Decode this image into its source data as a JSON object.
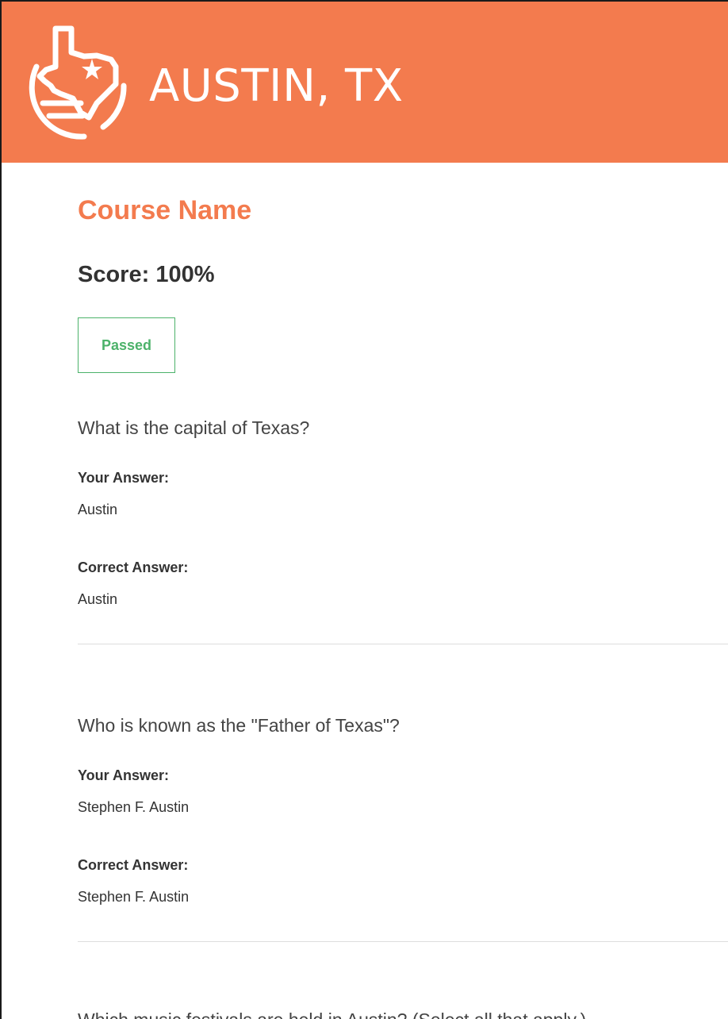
{
  "header": {
    "brand_title": "AUSTIN, TX",
    "logo_icon": "texas-map-star-icon",
    "background_color": "#f37b4e"
  },
  "course": {
    "name": "Course Name",
    "score_text": "Score: 100%",
    "status_badge": "Passed",
    "status_color": "#4cb26a"
  },
  "questions": [
    {
      "question": "What is the capital of Texas?",
      "your_answer_label": "Your Answer:",
      "your_answer": "Austin",
      "correct_answer_label": "Correct Answer:",
      "correct_answer": "Austin"
    },
    {
      "question": "Who is known as the \"Father of Texas\"?",
      "your_answer_label": "Your Answer:",
      "your_answer": "Stephen F. Austin",
      "correct_answer_label": "Correct Answer:",
      "correct_answer": "Stephen F. Austin"
    },
    {
      "question": "Which music festivals are held in Austin? (Select all that apply.)"
    }
  ]
}
